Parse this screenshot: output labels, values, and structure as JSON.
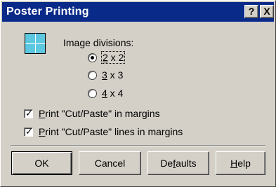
{
  "window": {
    "title": "Poster Printing",
    "help_button": "?",
    "close_button": "X"
  },
  "divisions": {
    "label": "Image divisions:",
    "options": [
      {
        "key": "2",
        "rest": " x 2",
        "selected": true
      },
      {
        "key": "3",
        "rest": " x 3",
        "selected": false
      },
      {
        "key": "4",
        "rest": " x 4",
        "selected": false
      }
    ]
  },
  "checkboxes": [
    {
      "key": "P",
      "rest": "rint \"Cut/Paste\" in margins",
      "checked": true
    },
    {
      "key": "P",
      "rest": "rint \"Cut/Paste\" lines in margins",
      "checked": true
    }
  ],
  "buttons": {
    "ok": "OK",
    "cancel": "Cancel",
    "defaults_pre": "De",
    "defaults_key": "f",
    "defaults_post": "aults",
    "help_key": "H",
    "help_post": "elp"
  },
  "icon": "grid-2x2-icon",
  "colors": {
    "titlebar": "#0a2a8a",
    "face": "#d4d0c8",
    "icon_fill": "#5cc8e0"
  }
}
